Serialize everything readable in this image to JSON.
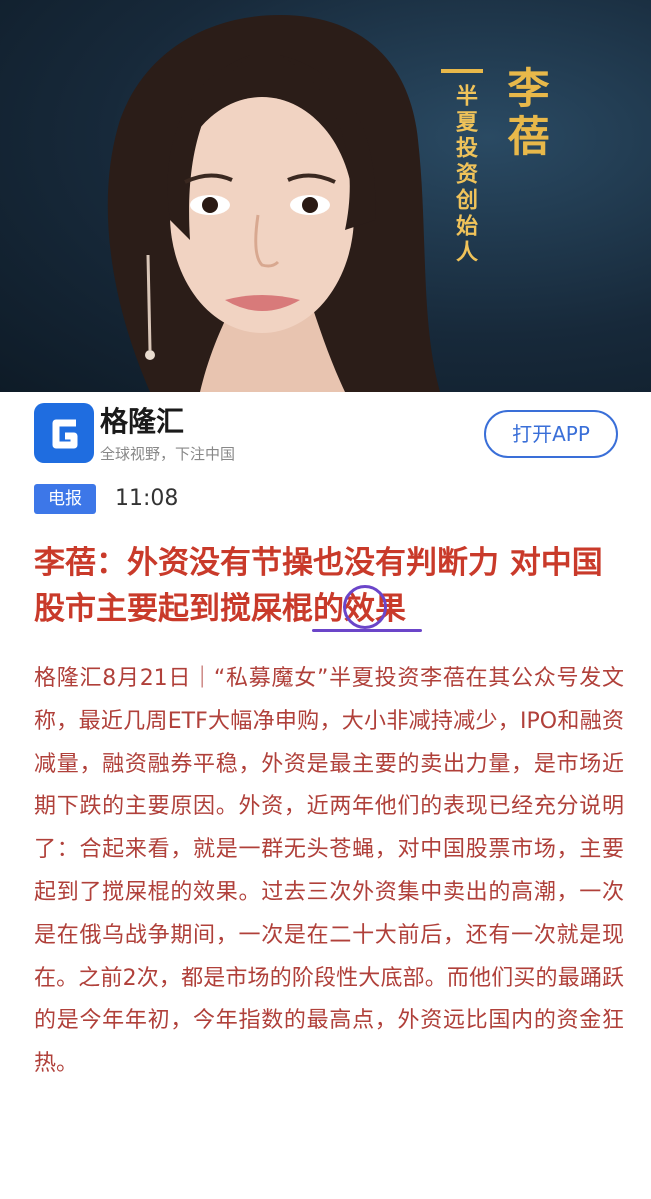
{
  "hero": {
    "name": "李蓓",
    "title": "半夏投资创始人"
  },
  "app": {
    "name": "格隆汇",
    "slogan": "全球视野，下注中国",
    "open_button": "打开APP",
    "brand_color": "#1f6de0"
  },
  "article": {
    "tag": "电报",
    "time": "11:08",
    "headline": "李蓓：外资没有节操也没有判断力 对中国股市主要起到搅屎棍的效果",
    "body": "格隆汇8月21日｜“私募魔女”半夏投资李蓓在其公众号发文称，最近几周ETF大幅净申购，大小非减持减少，IPO和融资减量，融资融券平稳，外资是最主要的卖出力量，是市场近期下跌的主要原因。外资，近两年他们的表现已经充分说明了：合起来看，就是一群无头苍蝇，对中国股票市场，主要起到了搅屎棍的效果。过去三次外资集中卖出的高潮，一次是在俄乌战争期间，一次是在二十大前后，还有一次就是现在。之前2次，都是市场的阶段性大底部。而他们买的最踊跃的是今年年初，今年指数的最高点，外资远比国内的资金狂热。",
    "headline_color": "#c93a2a",
    "body_color": "#b0403a",
    "annotation_color": "#6b45c9"
  }
}
